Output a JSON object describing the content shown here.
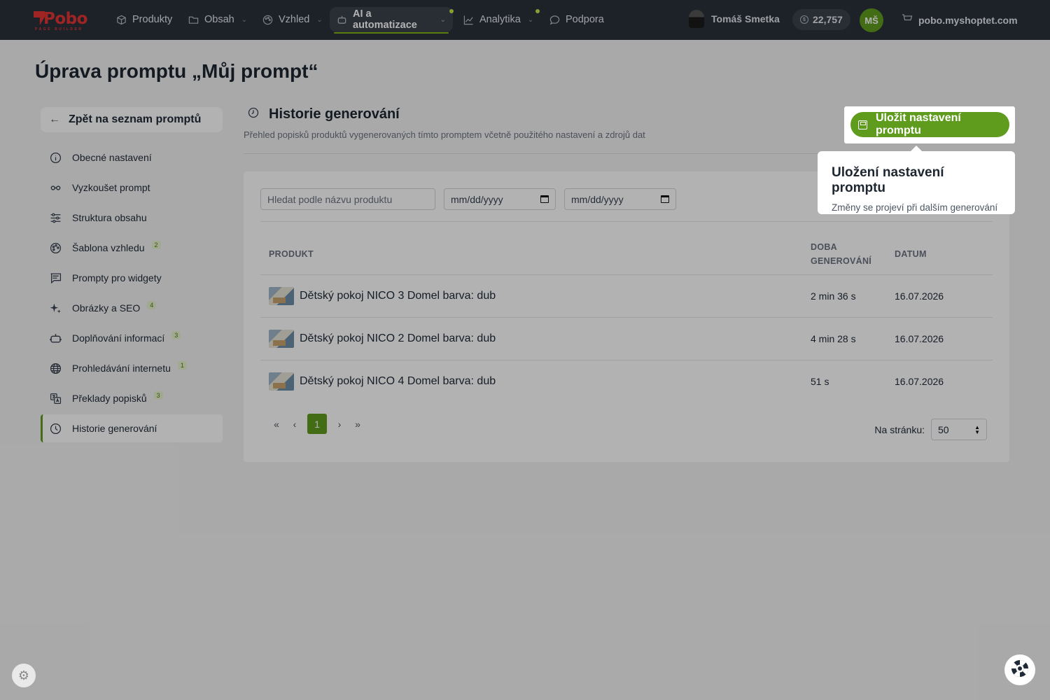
{
  "nav": {
    "logo_text": "Pobo",
    "logo_sub": "PAGE BUILDER",
    "items": [
      {
        "label": "Produkty",
        "icon": "box-icon"
      },
      {
        "label": "Obsah",
        "icon": "folder-icon"
      },
      {
        "label": "Vzhled",
        "icon": "palette-icon"
      },
      {
        "label": "AI a automatizace",
        "icon": "robot-icon"
      },
      {
        "label": "Analytika",
        "icon": "chart-line-icon"
      },
      {
        "label": "Podpora",
        "icon": "chat-icon"
      }
    ],
    "user_name": "Tomáš Smetka",
    "credits": "22,757",
    "avatar_initials": "MŠ",
    "shop": "pobo.myshoptet.com"
  },
  "page": {
    "title": "Úprava promptu „Můj prompt“",
    "back_label": "Zpět na seznam promptů"
  },
  "sidebar": {
    "items": [
      {
        "label": "Obecné nastavení",
        "badge": ""
      },
      {
        "label": "Vyzkoušet prompt",
        "badge": ""
      },
      {
        "label": "Struktura obsahu",
        "badge": ""
      },
      {
        "label": "Šablona vzhledu",
        "badge": "2"
      },
      {
        "label": "Prompty pro widgety",
        "badge": ""
      },
      {
        "label": "Obrázky a SEO",
        "badge": "4"
      },
      {
        "label": "Doplňování informací",
        "badge": "3"
      },
      {
        "label": "Prohledávání internetu",
        "badge": "1"
      },
      {
        "label": "Překlady popisků",
        "badge": "3"
      },
      {
        "label": "Historie generování",
        "badge": ""
      }
    ]
  },
  "section": {
    "title": "Historie generování",
    "description": "Přehled popisků produktů vygenerovaných tímto promptem včetně použitého nastavení a zdrojů dat"
  },
  "filters": {
    "search_placeholder": "Hledat podle názvu produktu",
    "date_from": "mm/dd/yyyy",
    "date_to": "mm/dd/yyyy"
  },
  "table": {
    "col_product": "PRODUKT",
    "col_duration_1": "DOBA",
    "col_duration_2": "GENEROVÁNÍ",
    "col_date": "DATUM",
    "rows": [
      {
        "product": "Dětský pokoj NICO 3 Domel barva: dub",
        "duration": "2 min 36 s",
        "date": "16.07.2026"
      },
      {
        "product": "Dětský pokoj NICO 2 Domel barva: dub",
        "duration": "4 min 28 s",
        "date": "16.07.2026"
      },
      {
        "product": "Dětský pokoj NICO 4 Domel barva: dub",
        "duration": "51 s",
        "date": "16.07.2026"
      }
    ]
  },
  "pagination": {
    "first": "«",
    "prev": "‹",
    "current": "1",
    "next": "›",
    "last": "»",
    "per_page_label": "Na stránku:",
    "per_page_value": "50"
  },
  "save": {
    "button_label": "Uložit nastavení promptu",
    "tooltip_title": "Uložení nastavení promptu",
    "tooltip_desc": "Změny se projeví při dalším generování"
  },
  "colors": {
    "accent": "#5f9c1e",
    "topbar": "#2a313b",
    "logo": "#e63434"
  }
}
